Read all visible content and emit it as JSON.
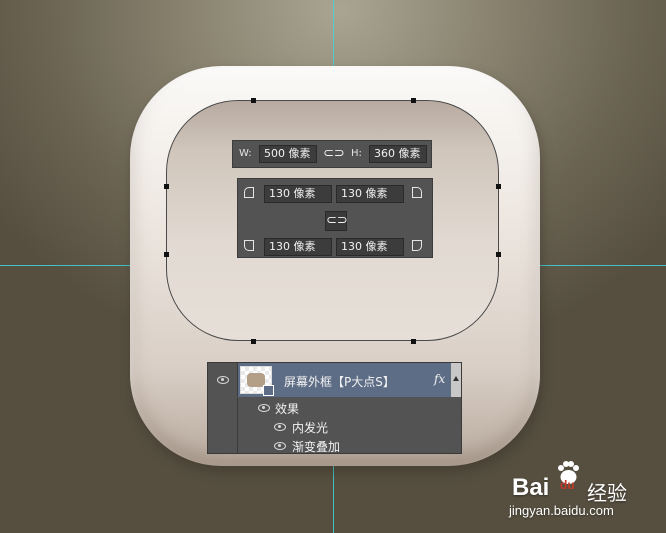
{
  "dimensions": {
    "w_label": "W:",
    "w_value": "500 像素",
    "h_label": "H:",
    "h_value": "360 像素"
  },
  "corner_radii": {
    "top_left": "130 像素",
    "top_right": "130 像素",
    "bottom_left": "130 像素",
    "bottom_right": "130 像素"
  },
  "icons": {
    "link": "⊂⊃"
  },
  "layers": {
    "layer_name": "屏幕外框【P大点S】",
    "fx_label": "fx",
    "effects_label": "效果",
    "effect_items": [
      "内发光",
      "渐变叠加"
    ]
  },
  "watermark": {
    "brand": "Bai",
    "brand_paw": "du",
    "brand_cn": "经验",
    "url": "jingyan.baidu.com"
  },
  "colors": {
    "guide": "#3fd6dc",
    "panel": "#535353",
    "layer_highlight": "#5e6d86"
  }
}
